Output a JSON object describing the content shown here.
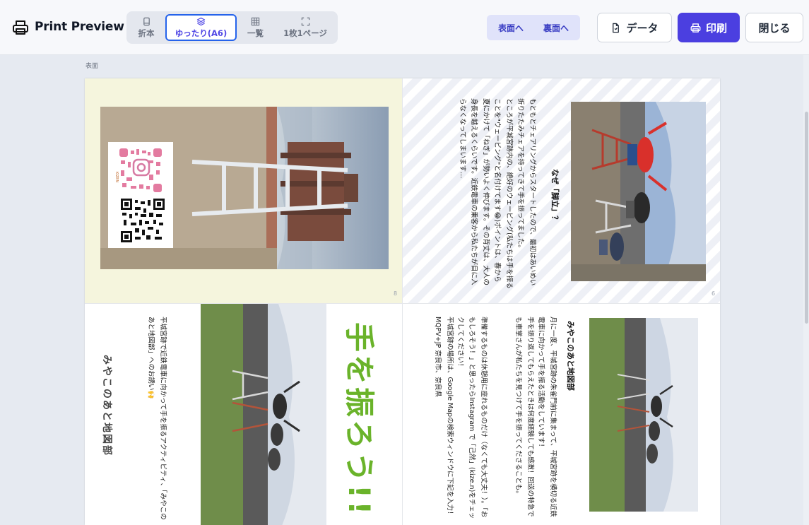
{
  "header": {
    "title": "Print Preview",
    "modes": [
      {
        "label": "折本",
        "icon": "booklet-icon"
      },
      {
        "label": "ゆったり(A6)",
        "icon": "layers-icon",
        "active": true
      },
      {
        "label": "一覧",
        "icon": "grid-icon"
      },
      {
        "label": "1枚1ページ",
        "icon": "expand-icon"
      }
    ],
    "side_front": "表面へ",
    "side_back": "裏面へ",
    "data_button": "データ",
    "print_button": "印刷",
    "close_button": "閉じる"
  },
  "section_label": "表面",
  "panels": {
    "top_left": {
      "page_number": "8",
      "qr_brand": "KIZEN"
    },
    "top_right": {
      "page_number": "6",
      "heading": "なぜ「脚立」？",
      "paragraph1": "もともとチェアリングからスタートしたので、最初はあいめい折りたたみチェアを持ってきて手を振ってました。",
      "paragraph2": "ところが平城宮跡内の、絶好のウェービング(私たちは手を振ることを\"ウェービング\"と名付けてます😂)ポイントは、春から夏にかけて「ねぎ」が勢いよく伸びます。その背丈は、大人の身長を越えるくらいです。近鉄電車の乗客から私たちが目に入らなくなってしまいます…"
    },
    "bottom_left": {
      "title": "手を振ろう!!",
      "invite": "平城宮跡で近鉄電車に向かって手を振るアクティビティ、「みやこのあと地図部」へのお誘い🙌",
      "club": "みやこのあと地図部"
    },
    "bottom_right": {
      "heading": "みやこのあと地図部",
      "paragraph1": "月に一度、平城宮跡の朱雀門前に集まって、平城宮跡を横切る近鉄電車に向かって手を振る活動をしています！",
      "paragraph2": "手を振り返してもらえたときは何度経験しても感激！回送の特急でも車掌さんが私たちを見つけて手を振ってくださることも。",
      "paragraph3": "準備するものは休憩用に座れるものだけ（なくても大丈夫！）。「おもしろそう！」と思ったらInstagram で「己然」(kize.n)をチェックしてください！",
      "paragraph4": "平城宮跡の場所は、Google Mapの検索ウィンドウに下記を入力！MQPV+JP 奈良市、奈良県"
    }
  },
  "colors": {
    "accent": "#4b3fe0",
    "active_border": "#2563eb",
    "title_green": "#6ab32a",
    "cover_bg": "#f5f5dd"
  }
}
